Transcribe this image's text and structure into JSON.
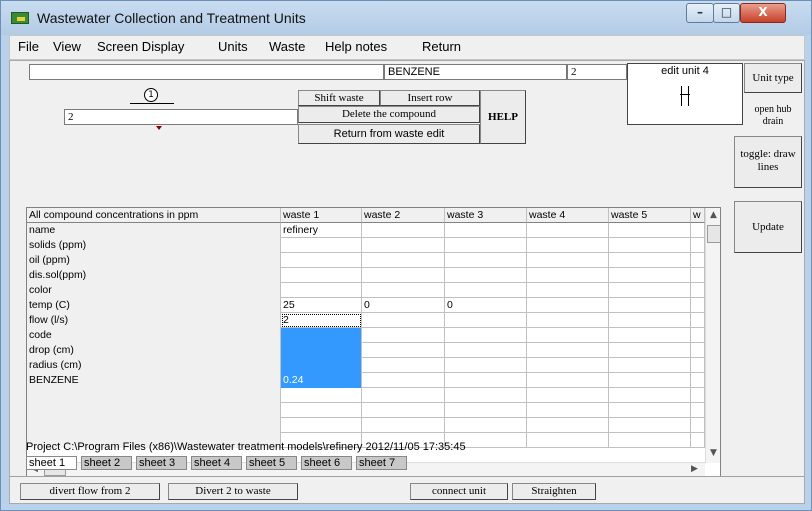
{
  "window": {
    "title": "Wastewater Collection and Treatment Units",
    "buttons": {
      "minimize": "–",
      "maximize": "□",
      "close": "X"
    }
  },
  "menu": [
    "File",
    "View",
    "Screen Display",
    "Units",
    "Waste",
    "Help notes",
    "Return"
  ],
  "top": {
    "left_field": "",
    "compound_field": "BENZENE",
    "number_field": "2",
    "node_label": "1",
    "unit_number_field": "2"
  },
  "buttons": {
    "shift_waste": "Shift waste",
    "insert_row": "Insert row",
    "delete_compound": "Delete the compound",
    "return_waste_edit": "Return from waste edit",
    "help": "HELP"
  },
  "edit_unit": {
    "label": "edit unit 4"
  },
  "side": {
    "unit_type": "Unit type",
    "unit_name": "open hub drain",
    "toggle": "toggle: draw lines",
    "update": "Update"
  },
  "grid": {
    "columns": [
      "All compound concentrations in ppm",
      "waste 1",
      "waste 2",
      "waste 3",
      "waste 4",
      "waste 5",
      "w"
    ],
    "rows": [
      [
        "name",
        "refinery",
        "",
        "",
        "",
        "",
        ""
      ],
      [
        "solids (ppm)",
        "",
        "",
        "",
        "",
        "",
        ""
      ],
      [
        "oil (ppm)",
        "",
        "",
        "",
        "",
        "",
        ""
      ],
      [
        "dis.sol(ppm)",
        "",
        "",
        "",
        "",
        "",
        ""
      ],
      [
        "color",
        "",
        "",
        "",
        "",
        "",
        ""
      ],
      [
        "temp (C)",
        "25",
        "0",
        "0",
        "",
        "",
        ""
      ],
      [
        "flow (l/s)",
        "2",
        "",
        "",
        "",
        "",
        ""
      ],
      [
        "code",
        "",
        "",
        "",
        "",
        "",
        ""
      ],
      [
        "drop (cm)",
        "",
        "",
        "",
        "",
        "",
        ""
      ],
      [
        "radius (cm)",
        "",
        "",
        "",
        "",
        "",
        ""
      ],
      [
        "BENZENE",
        "0.24",
        "",
        "",
        "",
        "",
        ""
      ],
      [
        "",
        "",
        "",
        "",
        "",
        "",
        ""
      ],
      [
        "",
        "",
        "",
        "",
        "",
        "",
        ""
      ],
      [
        "",
        "",
        "",
        "",
        "",
        "",
        ""
      ],
      [
        "",
        "",
        "",
        "",
        "",
        "",
        ""
      ]
    ]
  },
  "status": {
    "project": "Project C:\\Program Files (x86)\\Wastewater treatment models\\refinery 2012/11/05 17:35:45"
  },
  "sheets": [
    "sheet 1",
    "sheet 2",
    "sheet 3",
    "sheet 4",
    "sheet 5",
    "sheet 6",
    "sheet 7"
  ],
  "bottom": {
    "divert_flow": "divert flow from  2",
    "divert_waste": "Divert 2 to waste",
    "connect_unit": "connect unit",
    "straighten": "Straighten"
  }
}
